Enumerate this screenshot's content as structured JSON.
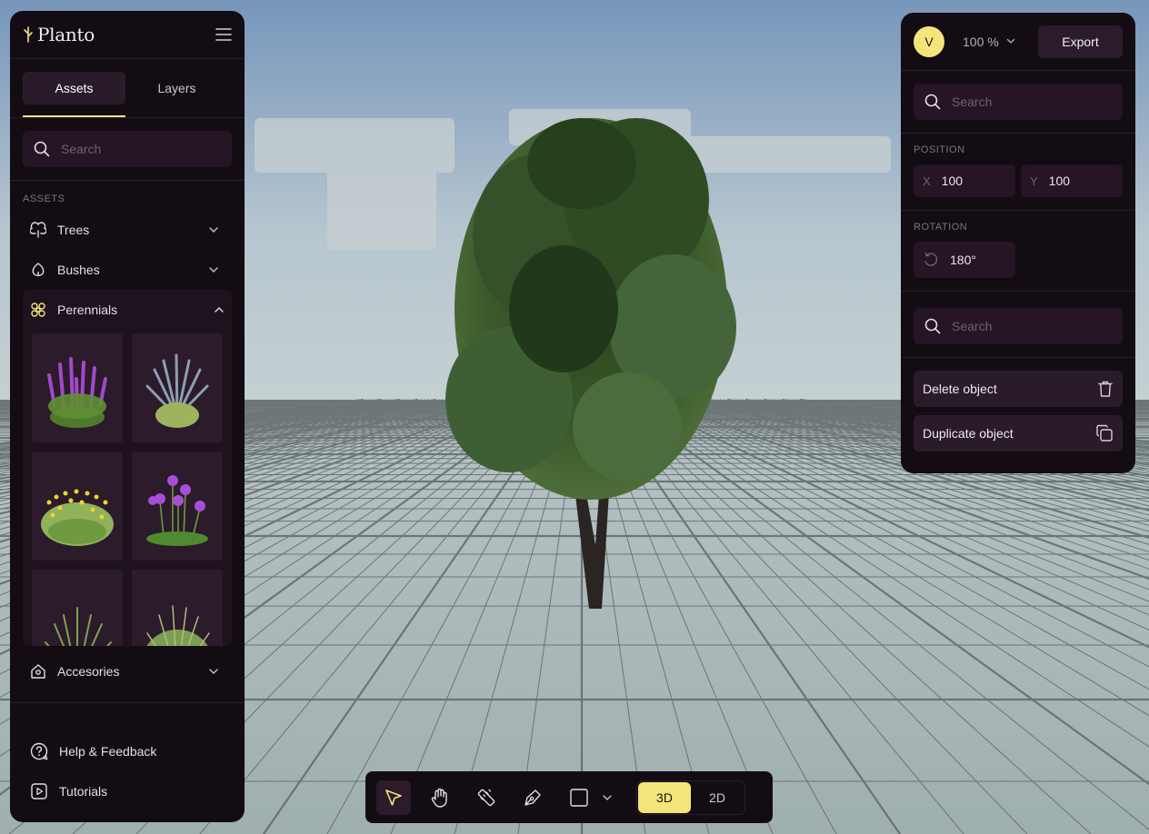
{
  "brand": {
    "name": "Planto"
  },
  "tabs": [
    {
      "label": "Assets"
    },
    {
      "label": "Layers"
    }
  ],
  "left_search": {
    "placeholder": "Search"
  },
  "assets": {
    "section_label": "ASSETS",
    "categories": [
      {
        "label": "Trees",
        "icon": "tree-icon",
        "expanded": false
      },
      {
        "label": "Bushes",
        "icon": "bush-icon",
        "expanded": false
      },
      {
        "label": "Perennials",
        "icon": "flower-icon",
        "expanded": true
      },
      {
        "label": "Accesories",
        "icon": "house-icon",
        "expanded": false
      }
    ],
    "perennial_tiles": [
      {
        "icon": "purple-loosestrife-plant"
      },
      {
        "icon": "russian-sage-plant"
      },
      {
        "icon": "yellow-coreopsis-plant"
      },
      {
        "icon": "allium-plant"
      },
      {
        "icon": "ornamental-grass-plant"
      },
      {
        "icon": "fountain-grass-plant"
      }
    ]
  },
  "footer": [
    {
      "label": "Help & Feedback",
      "icon": "help-icon"
    },
    {
      "label": "Tutorials",
      "icon": "play-icon"
    }
  ],
  "header": {
    "avatar_initial": "V",
    "zoom": "100 %",
    "export_label": "Export"
  },
  "right_search_top": {
    "placeholder": "Search"
  },
  "position": {
    "label": "POSITION",
    "x_key": "X",
    "x": "100",
    "y_key": "Y",
    "y": "100"
  },
  "rotation": {
    "label": "ROTATION",
    "value": "180°"
  },
  "right_search_bottom": {
    "placeholder": "Search"
  },
  "actions": {
    "delete_label": "Delete object",
    "duplicate_label": "Duplicate object"
  },
  "toolbar": {
    "tools": [
      "select-icon",
      "hand-icon",
      "ruler-icon",
      "pen-icon",
      "rectangle-icon"
    ],
    "view_3d": "3D",
    "view_2d": "2D",
    "active_view": "3D"
  },
  "colors": {
    "panel": "#130c13",
    "accent_yellow": "#f4e57b",
    "sky": "#7f9cbd",
    "ground": "#a8b4b5",
    "foliage": "#2f4a22"
  }
}
